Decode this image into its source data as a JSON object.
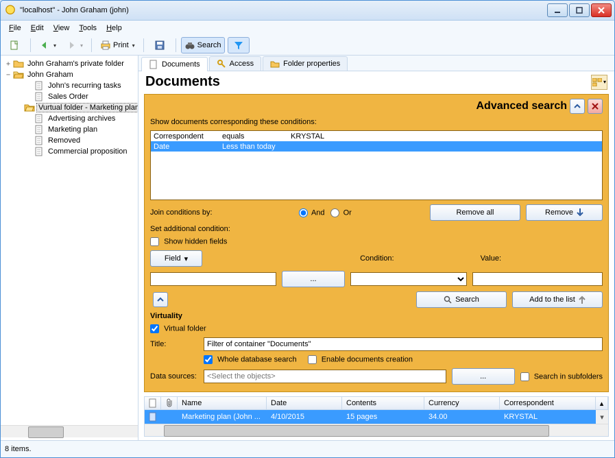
{
  "window": {
    "title": "\"localhost\" - John Graham (john)"
  },
  "menu": {
    "file": "File",
    "edit": "Edit",
    "view": "View",
    "tools": "Tools",
    "help": "Help"
  },
  "toolbar": {
    "print": "Print",
    "search": "Search"
  },
  "tree": {
    "root1": "John Graham's private folder",
    "root2": "John Graham",
    "items": [
      "John's recurring tasks",
      "Sales Order",
      "Vurtual folder - Marketing plan",
      "Advertising archives",
      "Marketing plan",
      "Removed",
      "Commercial proposition"
    ],
    "selected_index": 2
  },
  "tabs": {
    "documents": "Documents",
    "access": "Access",
    "props": "Folder properties"
  },
  "page": {
    "heading": "Documents"
  },
  "adv": {
    "title": "Advanced search",
    "show_cond_label": "Show documents corresponding these conditions:",
    "conditions": [
      {
        "field": "Correspondent",
        "op": "equals",
        "val": "KRYSTAL",
        "selected": false
      },
      {
        "field": "Date",
        "op": "Less than today",
        "val": "",
        "selected": true
      }
    ],
    "join_label": "Join conditions by:",
    "and": "And",
    "or": "Or",
    "join_selected": "and",
    "remove_all": "Remove all",
    "remove": "Remove",
    "set_add_label": "Set additional condition:",
    "show_hidden": "Show hidden fields",
    "show_hidden_checked": false,
    "field_btn": "Field",
    "cond_label": "Condition:",
    "value_label": "Value:",
    "search_btn": "Search",
    "add_list": "Add to the list",
    "virtuality": "Virtuality",
    "virtual_folder": "Virtual folder",
    "virtual_checked": true,
    "title_label": "Title:",
    "title_value": "Filter of container \"Documents\"",
    "whole_db": "Whole database search",
    "whole_db_checked": true,
    "enable_create": "Enable documents creation",
    "enable_create_checked": false,
    "data_sources": "Data sources:",
    "ds_placeholder": "<Select the objects>",
    "search_subfolders": "Search in subfolders",
    "search_subfolders_checked": false
  },
  "grid": {
    "cols": {
      "name": "Name",
      "date": "Date",
      "contents": "Contents",
      "currency": "Currency",
      "correspondent": "Correspondent"
    },
    "row": {
      "name": "Marketing plan (John ...",
      "date": "4/10/2015",
      "contents": "15 pages",
      "currency": "34.00",
      "correspondent": "KRYSTAL"
    }
  },
  "status": {
    "text": "8 items."
  }
}
